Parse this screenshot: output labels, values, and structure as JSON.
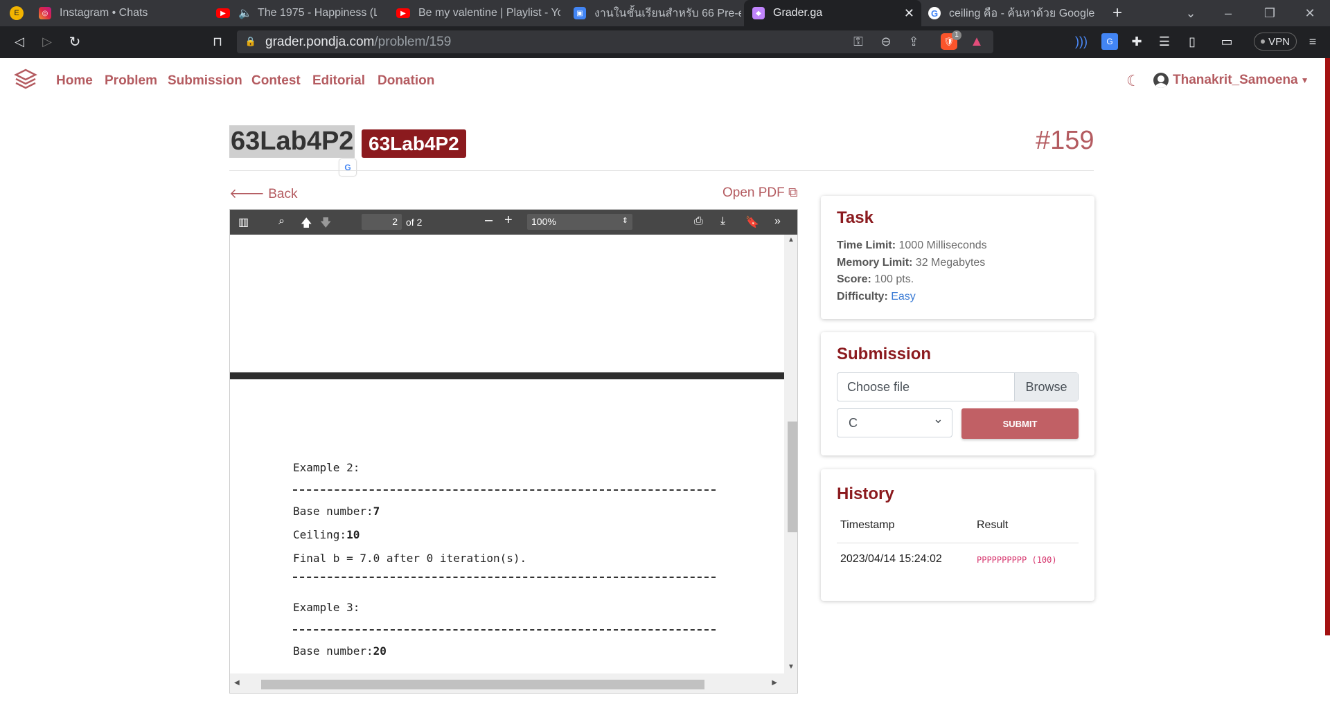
{
  "browser": {
    "tabs": [
      {
        "label": "Instagram • Chats"
      },
      {
        "label": "The 1975 - Happiness (Live"
      },
      {
        "label": "Be my valentine | Playlist - YouT"
      },
      {
        "label": "งานในชั้นเรียนสำหรับ 66 Pre-en Co"
      },
      {
        "label": "Grader.ga"
      },
      {
        "label": "ceiling คือ - ค้นหาด้วย Google"
      }
    ],
    "url_host": "grader.pondja.com",
    "url_path": "/problem/159",
    "vpn_label": "VPN",
    "ext_badge": "1"
  },
  "nav": {
    "links": [
      "Home",
      "Problem",
      "Submission",
      "Contest",
      "Editorial",
      "Donation"
    ],
    "user": "Thanakrit_Samoena"
  },
  "problem": {
    "title": "63Lab4P2",
    "badge": "63Lab4P2",
    "id": "#159",
    "back": "Back",
    "open_pdf": "Open PDF"
  },
  "pdf": {
    "page": "2",
    "of": "of 2",
    "zoom": "100%",
    "lines": {
      "ex2": "Example 2:",
      "base_label": "Base number:",
      "base_val": "7",
      "ceil_label": "Ceiling:",
      "ceil_val": "10",
      "final": "Final b = 7.0 after 0 iteration(s).",
      "ex3": "Example 3:",
      "base_label2": "Base number:",
      "base_val2": "20"
    }
  },
  "task": {
    "title": "Task",
    "time_label": "Time Limit:",
    "time_value": "1000 Milliseconds",
    "memory_label": "Memory Limit:",
    "memory_value": "32 Megabytes",
    "score_label": "Score:",
    "score_value": "100 pts.",
    "difficulty_label": "Difficulty:",
    "difficulty_value": "Easy"
  },
  "submission": {
    "title": "Submission",
    "file_placeholder": "Choose file",
    "browse": "Browse",
    "language": "C",
    "submit": "SUBMIT"
  },
  "history": {
    "title": "History",
    "headers": [
      "Timestamp",
      "Result"
    ],
    "rows": [
      {
        "timestamp": "2023/04/14 15:24:02",
        "result": "PPPPPPPPPP (100)"
      }
    ]
  },
  "colors": {
    "accent": "#b45b60",
    "heading": "#8b1a1e",
    "submit": "#c16065"
  }
}
